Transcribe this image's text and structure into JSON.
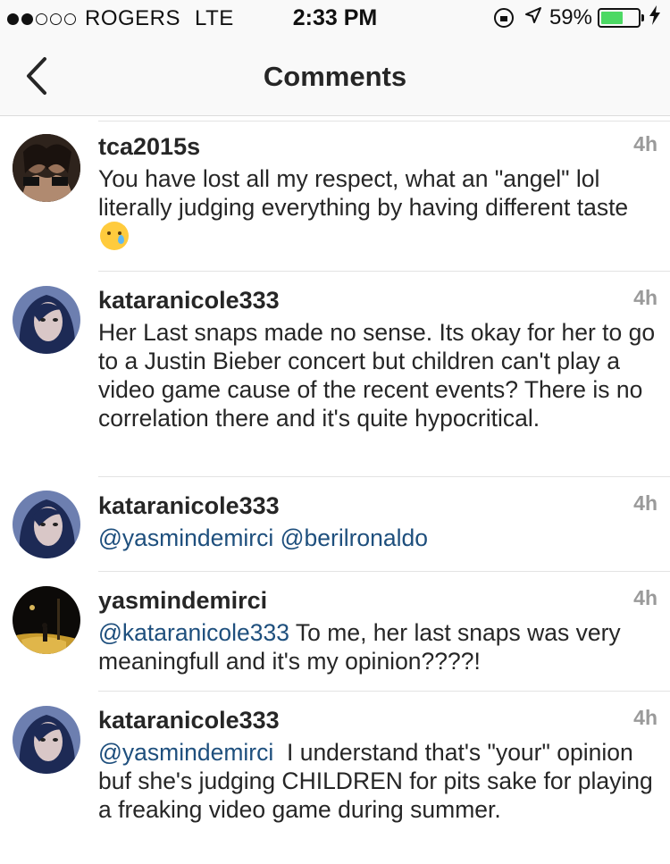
{
  "status_bar": {
    "carrier": "ROGERS",
    "network": "LTE",
    "time": "2:33 PM",
    "battery_text": "59%",
    "battery_level": 0.59,
    "signal_filled": 2,
    "signal_total": 5
  },
  "nav": {
    "back_icon": "chevron-left-icon",
    "title": "Comments"
  },
  "colors": {
    "mention": "#1e4f7d",
    "timestamp": "#9a9a9a",
    "battery": "#4cd964"
  },
  "comments": [
    {
      "username": "tca2015s",
      "time": "4h",
      "text_before": "You have lost all my respect, what an \"angel\" lol literally judging everything by having different taste",
      "emoji": "crying-face-icon"
    },
    {
      "username": "katarанicole333",
      "time": "4h",
      "text": "Her Last snaps made no sense. Its okay for her to go to a Justin Bieber concert but children can't play a video game cause of the recent events? There is no correlation  there and it's quite hypocritical."
    },
    {
      "username": "katarанicole333",
      "time": "4h",
      "mentions": [
        "@yasmindemirci",
        "@berilronaldo"
      ]
    },
    {
      "username": "yasmindemirci",
      "time": "4h",
      "mention": "@katarанicole333",
      "text": " To me, her last snaps was very meaningfull and it's my opinion????!"
    },
    {
      "username": "katarанicole333",
      "time": "4h",
      "mention": "@yasmindemirci",
      "text": "  I understand that's \"your\" opinion buf she's judging CHILDREN for pits sake for playing a freaking video game during summer."
    }
  ]
}
